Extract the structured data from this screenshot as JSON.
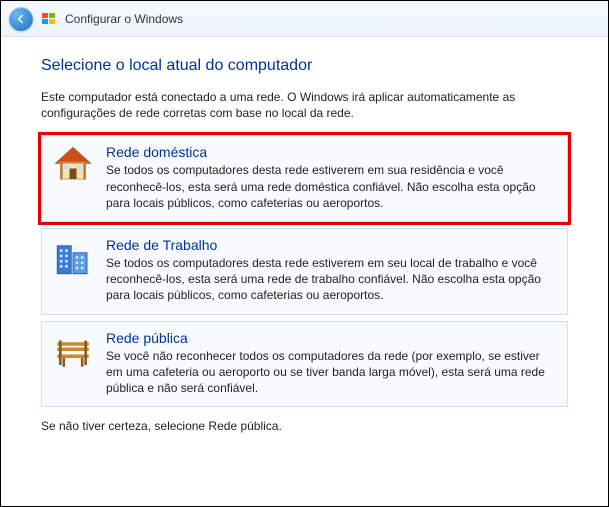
{
  "titlebar": {
    "title": "Configurar o Windows"
  },
  "main": {
    "heading": "Selecione o local atual do computador",
    "intro": "Este computador está conectado a uma rede. O Windows irá aplicar automaticamente as configurações de rede corretas com base no local da rede.",
    "options": [
      {
        "title": "Rede doméstica",
        "desc": "Se todos os computadores desta rede estiverem em sua residência e você reconhecê-los, esta será uma rede doméstica confiável. Não escolha esta opção para locais públicos, como cafeterias ou aeroportos."
      },
      {
        "title": "Rede de Trabalho",
        "desc": "Se todos os computadores desta rede estiverem em seu local de trabalho e você reconhecê-los, esta será uma rede de trabalho confiável. Não escolha esta opção para locais públicos, como cafeterias ou aeroportos."
      },
      {
        "title": "Rede pública",
        "desc": "Se você não reconhecer todos os computadores da rede (por exemplo, se estiver em uma cafeteria ou aeroporto ou se tiver banda larga móvel), esta será uma rede pública e não será confiável."
      }
    ],
    "footer": "Se não tiver certeza, selecione Rede pública."
  },
  "colors": {
    "accent": "#003399",
    "highlight": "#e60000"
  }
}
